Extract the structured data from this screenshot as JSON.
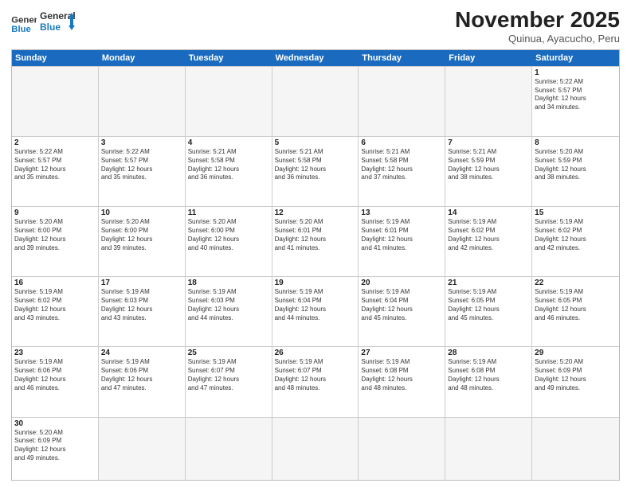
{
  "header": {
    "logo_general": "General",
    "logo_blue": "Blue",
    "month_title": "November 2025",
    "subtitle": "Quinua, Ayacucho, Peru"
  },
  "days_of_week": [
    "Sunday",
    "Monday",
    "Tuesday",
    "Wednesday",
    "Thursday",
    "Friday",
    "Saturday"
  ],
  "weeks": [
    [
      {
        "num": "",
        "info": ""
      },
      {
        "num": "",
        "info": ""
      },
      {
        "num": "",
        "info": ""
      },
      {
        "num": "",
        "info": ""
      },
      {
        "num": "",
        "info": ""
      },
      {
        "num": "",
        "info": ""
      },
      {
        "num": "1",
        "info": "Sunrise: 5:22 AM\nSunset: 5:57 PM\nDaylight: 12 hours\nand 34 minutes."
      }
    ],
    [
      {
        "num": "2",
        "info": "Sunrise: 5:22 AM\nSunset: 5:57 PM\nDaylight: 12 hours\nand 35 minutes."
      },
      {
        "num": "3",
        "info": "Sunrise: 5:22 AM\nSunset: 5:57 PM\nDaylight: 12 hours\nand 35 minutes."
      },
      {
        "num": "4",
        "info": "Sunrise: 5:21 AM\nSunset: 5:58 PM\nDaylight: 12 hours\nand 36 minutes."
      },
      {
        "num": "5",
        "info": "Sunrise: 5:21 AM\nSunset: 5:58 PM\nDaylight: 12 hours\nand 36 minutes."
      },
      {
        "num": "6",
        "info": "Sunrise: 5:21 AM\nSunset: 5:58 PM\nDaylight: 12 hours\nand 37 minutes."
      },
      {
        "num": "7",
        "info": "Sunrise: 5:21 AM\nSunset: 5:59 PM\nDaylight: 12 hours\nand 38 minutes."
      },
      {
        "num": "8",
        "info": "Sunrise: 5:20 AM\nSunset: 5:59 PM\nDaylight: 12 hours\nand 38 minutes."
      }
    ],
    [
      {
        "num": "9",
        "info": "Sunrise: 5:20 AM\nSunset: 6:00 PM\nDaylight: 12 hours\nand 39 minutes."
      },
      {
        "num": "10",
        "info": "Sunrise: 5:20 AM\nSunset: 6:00 PM\nDaylight: 12 hours\nand 39 minutes."
      },
      {
        "num": "11",
        "info": "Sunrise: 5:20 AM\nSunset: 6:00 PM\nDaylight: 12 hours\nand 40 minutes."
      },
      {
        "num": "12",
        "info": "Sunrise: 5:20 AM\nSunset: 6:01 PM\nDaylight: 12 hours\nand 41 minutes."
      },
      {
        "num": "13",
        "info": "Sunrise: 5:19 AM\nSunset: 6:01 PM\nDaylight: 12 hours\nand 41 minutes."
      },
      {
        "num": "14",
        "info": "Sunrise: 5:19 AM\nSunset: 6:02 PM\nDaylight: 12 hours\nand 42 minutes."
      },
      {
        "num": "15",
        "info": "Sunrise: 5:19 AM\nSunset: 6:02 PM\nDaylight: 12 hours\nand 42 minutes."
      }
    ],
    [
      {
        "num": "16",
        "info": "Sunrise: 5:19 AM\nSunset: 6:02 PM\nDaylight: 12 hours\nand 43 minutes."
      },
      {
        "num": "17",
        "info": "Sunrise: 5:19 AM\nSunset: 6:03 PM\nDaylight: 12 hours\nand 43 minutes."
      },
      {
        "num": "18",
        "info": "Sunrise: 5:19 AM\nSunset: 6:03 PM\nDaylight: 12 hours\nand 44 minutes."
      },
      {
        "num": "19",
        "info": "Sunrise: 5:19 AM\nSunset: 6:04 PM\nDaylight: 12 hours\nand 44 minutes."
      },
      {
        "num": "20",
        "info": "Sunrise: 5:19 AM\nSunset: 6:04 PM\nDaylight: 12 hours\nand 45 minutes."
      },
      {
        "num": "21",
        "info": "Sunrise: 5:19 AM\nSunset: 6:05 PM\nDaylight: 12 hours\nand 45 minutes."
      },
      {
        "num": "22",
        "info": "Sunrise: 5:19 AM\nSunset: 6:05 PM\nDaylight: 12 hours\nand 46 minutes."
      }
    ],
    [
      {
        "num": "23",
        "info": "Sunrise: 5:19 AM\nSunset: 6:06 PM\nDaylight: 12 hours\nand 46 minutes."
      },
      {
        "num": "24",
        "info": "Sunrise: 5:19 AM\nSunset: 6:06 PM\nDaylight: 12 hours\nand 47 minutes."
      },
      {
        "num": "25",
        "info": "Sunrise: 5:19 AM\nSunset: 6:07 PM\nDaylight: 12 hours\nand 47 minutes."
      },
      {
        "num": "26",
        "info": "Sunrise: 5:19 AM\nSunset: 6:07 PM\nDaylight: 12 hours\nand 48 minutes."
      },
      {
        "num": "27",
        "info": "Sunrise: 5:19 AM\nSunset: 6:08 PM\nDaylight: 12 hours\nand 48 minutes."
      },
      {
        "num": "28",
        "info": "Sunrise: 5:19 AM\nSunset: 6:08 PM\nDaylight: 12 hours\nand 48 minutes."
      },
      {
        "num": "29",
        "info": "Sunrise: 5:20 AM\nSunset: 6:09 PM\nDaylight: 12 hours\nand 49 minutes."
      }
    ],
    [
      {
        "num": "30",
        "info": "Sunrise: 5:20 AM\nSunset: 6:09 PM\nDaylight: 12 hours\nand 49 minutes."
      },
      {
        "num": "",
        "info": ""
      },
      {
        "num": "",
        "info": ""
      },
      {
        "num": "",
        "info": ""
      },
      {
        "num": "",
        "info": ""
      },
      {
        "num": "",
        "info": ""
      },
      {
        "num": "",
        "info": ""
      }
    ]
  ]
}
